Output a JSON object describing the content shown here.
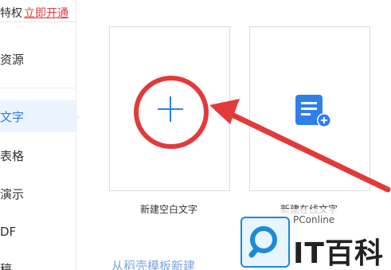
{
  "sidebar": {
    "banner_text": "特权",
    "banner_link": "立即开通",
    "items": [
      {
        "label": "资源"
      },
      {
        "label": "文字"
      },
      {
        "label": "表格"
      },
      {
        "label": "演示"
      },
      {
        "label": "DF"
      },
      {
        "label": "稿"
      }
    ]
  },
  "cards": {
    "blank_label": "新建空白文字",
    "online_label": "新建在线文字"
  },
  "template_link": "从稻壳模板新建",
  "watermark": {
    "pconline": "PConline",
    "brand": "IT百科"
  },
  "colors": {
    "accent": "#2f7fe8",
    "annotation": "#e23a3a",
    "link": "#e0393e"
  },
  "icons": {
    "plus": "plus-icon",
    "online_doc": "online-doc-icon",
    "magnifier": "search-icon"
  }
}
